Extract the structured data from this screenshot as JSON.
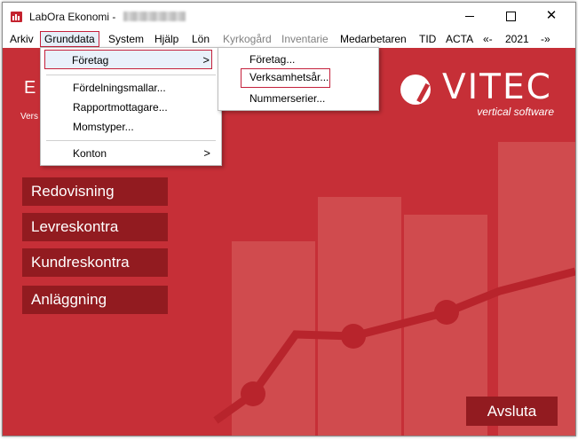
{
  "window": {
    "title": "LabOra Ekonomi  -",
    "close_glyph": "✕"
  },
  "menubar": {
    "items": [
      {
        "label": "Arkiv",
        "enabled": true
      },
      {
        "label": "Grunddata",
        "enabled": true,
        "active": true
      },
      {
        "label": "System",
        "enabled": true
      },
      {
        "label": "Hjälp",
        "enabled": true
      },
      {
        "label": "Lön",
        "enabled": true
      },
      {
        "label": "Kyrkogård",
        "enabled": false
      },
      {
        "label": "Inventarie",
        "enabled": false
      },
      {
        "label": "Medarbetaren",
        "enabled": true
      },
      {
        "label": "TID",
        "enabled": true
      },
      {
        "label": "ACTA",
        "enabled": true
      },
      {
        "label": "«-",
        "enabled": true
      },
      {
        "label": "2021",
        "enabled": true
      },
      {
        "label": "-»",
        "enabled": true
      }
    ]
  },
  "grunddata_menu": {
    "items": [
      {
        "label": "Företag",
        "submenu": true,
        "highlighted": true
      },
      {
        "label": "Fördelningsmallar...",
        "submenu": false
      },
      {
        "label": "Rapportmottagare...",
        "submenu": false
      },
      {
        "label": "Momstyper...",
        "submenu": false
      },
      {
        "label": "Konton",
        "submenu": true
      }
    ],
    "submenu_arrow": ">"
  },
  "foretag_submenu": {
    "items": [
      {
        "label": "Företag...",
        "highlighted": false
      },
      {
        "label": "Verksamhetsår...",
        "highlighted": true
      },
      {
        "label": "Nummerserier...",
        "highlighted": false
      }
    ]
  },
  "main": {
    "title": "E",
    "version": "Vers",
    "logo_text": "VITEC",
    "logo_subtitle": "vertical software",
    "nav_buttons": [
      {
        "label": "Redovisning"
      },
      {
        "label": "Levreskontra"
      },
      {
        "label": "Kundreskontra"
      },
      {
        "label": "Anläggning"
      }
    ],
    "exit_button": "Avsluta",
    "background_color": "#c62f37",
    "button_color": "#921b20",
    "highlight_color": "#c4203b"
  }
}
